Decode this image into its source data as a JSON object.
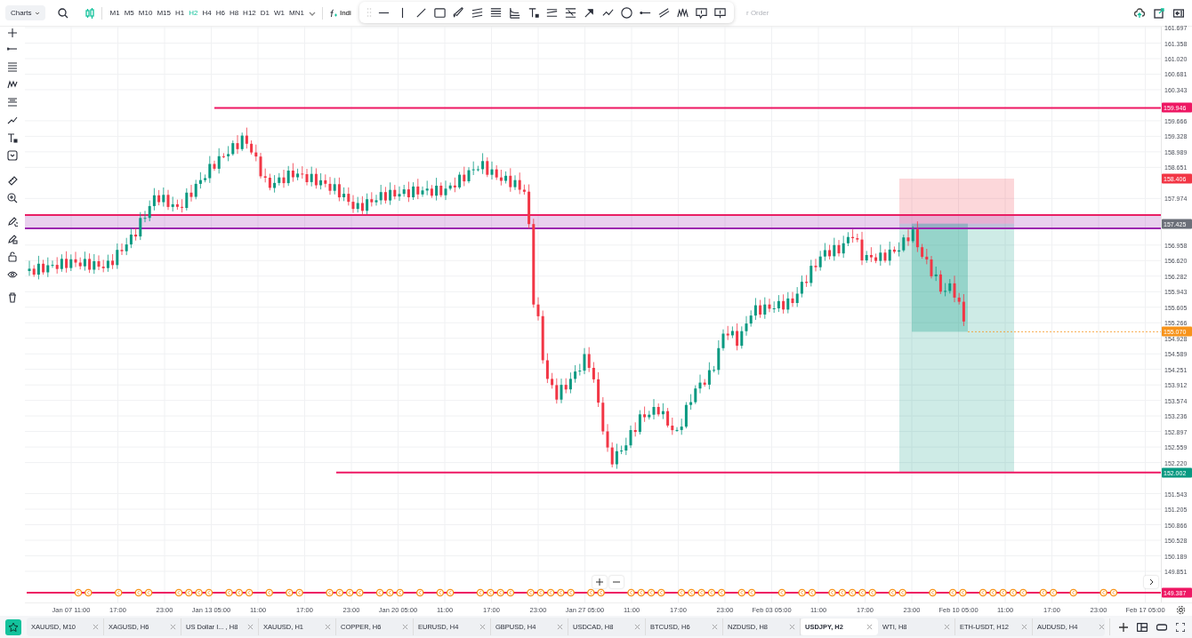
{
  "toolbar": {
    "symbol_menu": "Charts",
    "timeframes": [
      {
        "label": "M1",
        "selected": false
      },
      {
        "label": "M5",
        "selected": false
      },
      {
        "label": "M10",
        "selected": false
      },
      {
        "label": "M15",
        "selected": false
      },
      {
        "label": "H1",
        "selected": false
      },
      {
        "label": "H2",
        "selected": true
      },
      {
        "label": "H4",
        "selected": false
      },
      {
        "label": "H6",
        "selected": false
      },
      {
        "label": "H8",
        "selected": false
      },
      {
        "label": "H12",
        "selected": false
      },
      {
        "label": "D1",
        "selected": false
      },
      {
        "label": "W1",
        "selected": false
      },
      {
        "label": "MN1",
        "selected": false
      }
    ],
    "indicators_button": "Indi",
    "order_button": "r Order"
  },
  "price_axis": {
    "ticks": [
      "161.697",
      "161.358",
      "161.020",
      "160.681",
      "160.343",
      "159.666",
      "159.328",
      "158.989",
      "158.651",
      "157.974",
      "156.958",
      "156.620",
      "156.282",
      "155.943",
      "155.605",
      "155.266",
      "154.928",
      "154.589",
      "154.251",
      "153.912",
      "153.574",
      "153.236",
      "152.897",
      "152.559",
      "152.220",
      "151.543",
      "151.205",
      "150.866",
      "150.528",
      "150.189",
      "149.851"
    ],
    "markers": [
      {
        "value": "159.946",
        "kind": "line"
      },
      {
        "value": "158.406",
        "kind": "stop"
      },
      {
        "value": "157.425",
        "kind": "entry"
      },
      {
        "value": "155.070",
        "kind": "last"
      },
      {
        "value": "152.002",
        "kind": "target"
      },
      {
        "value": "149.387",
        "kind": "line"
      }
    ]
  },
  "time_axis": {
    "labels": [
      "Jan 07 11:00",
      "17:00",
      "23:00",
      "Jan 13 05:00",
      "11:00",
      "17:00",
      "23:00",
      "Jan 20 05:00",
      "11:00",
      "17:00",
      "23:00",
      "Jan 27 05:00",
      "11:00",
      "17:00",
      "23:00",
      "Feb 03 05:00",
      "11:00",
      "17:00",
      "23:00",
      "Feb 10 05:00",
      "11:00",
      "17:00",
      "23:00",
      "Feb 17 05:00"
    ]
  },
  "tabs": [
    {
      "label": "XAUUSD, M10",
      "selected": false
    },
    {
      "label": "XAGUSD, H6",
      "selected": false
    },
    {
      "label": "US Dollar I... , H8",
      "selected": false
    },
    {
      "label": "XAUUSD, H1",
      "selected": false
    },
    {
      "label": "COPPER, H6",
      "selected": false
    },
    {
      "label": "EURUSD, H4",
      "selected": false
    },
    {
      "label": "GBPUSD, H4",
      "selected": false
    },
    {
      "label": "USDCAD, H8",
      "selected": false
    },
    {
      "label": "BTCUSD, H6",
      "selected": false
    },
    {
      "label": "NZDUSD, H8",
      "selected": false
    },
    {
      "label": "USDJPY, H2",
      "selected": true
    },
    {
      "label": "WTI, H8",
      "selected": false
    },
    {
      "label": "ETH-USDT, H12",
      "selected": false
    },
    {
      "label": "AUDUSD, H4",
      "selected": false
    }
  ]
}
